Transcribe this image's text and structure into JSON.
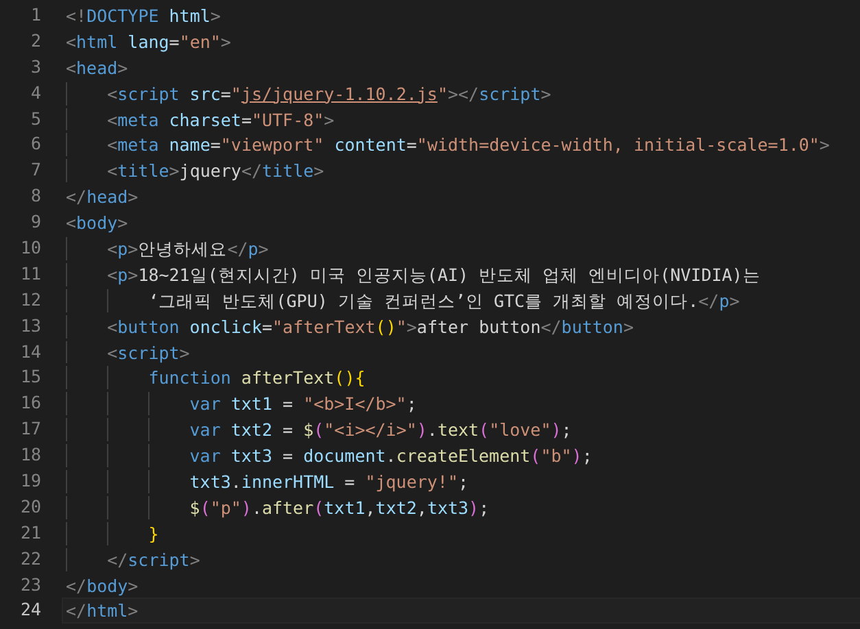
{
  "editor": {
    "lines": [
      {
        "number": "1",
        "current": false,
        "tokens": [
          {
            "kind": "punct",
            "text": "<!"
          },
          {
            "kind": "tag",
            "text": "DOCTYPE"
          },
          {
            "kind": "attr",
            "text": " html"
          },
          {
            "kind": "punct",
            "text": ">"
          }
        ]
      },
      {
        "number": "2",
        "current": false,
        "tokens": [
          {
            "kind": "punct",
            "text": "<"
          },
          {
            "kind": "tag",
            "text": "html"
          },
          {
            "kind": "attr",
            "text": " lang"
          },
          {
            "kind": "text",
            "text": "="
          },
          {
            "kind": "str",
            "text": "\"en\""
          },
          {
            "kind": "punct",
            "text": ">"
          }
        ]
      },
      {
        "number": "3",
        "current": false,
        "tokens": [
          {
            "kind": "punct",
            "text": "<"
          },
          {
            "kind": "tag",
            "text": "head"
          },
          {
            "kind": "punct",
            "text": ">"
          }
        ]
      },
      {
        "number": "4",
        "current": false,
        "tokens": [
          {
            "kind": "punct",
            "text": "    <"
          },
          {
            "kind": "tag",
            "text": "script"
          },
          {
            "kind": "attr",
            "text": " src"
          },
          {
            "kind": "text",
            "text": "="
          },
          {
            "kind": "str",
            "text": "\""
          },
          {
            "kind": "link",
            "text": "js/jquery-1.10.2.js"
          },
          {
            "kind": "str",
            "text": "\""
          },
          {
            "kind": "punct",
            "text": "></"
          },
          {
            "kind": "tag",
            "text": "script"
          },
          {
            "kind": "punct",
            "text": ">"
          }
        ]
      },
      {
        "number": "5",
        "current": false,
        "tokens": [
          {
            "kind": "punct",
            "text": "    <"
          },
          {
            "kind": "tag",
            "text": "meta"
          },
          {
            "kind": "attr",
            "text": " charset"
          },
          {
            "kind": "text",
            "text": "="
          },
          {
            "kind": "str",
            "text": "\"UTF-8\""
          },
          {
            "kind": "punct",
            "text": ">"
          }
        ]
      },
      {
        "number": "6",
        "current": false,
        "tokens": [
          {
            "kind": "punct",
            "text": "    <"
          },
          {
            "kind": "tag",
            "text": "meta"
          },
          {
            "kind": "attr",
            "text": " name"
          },
          {
            "kind": "text",
            "text": "="
          },
          {
            "kind": "str",
            "text": "\"viewport\""
          },
          {
            "kind": "attr",
            "text": " content"
          },
          {
            "kind": "text",
            "text": "="
          },
          {
            "kind": "str",
            "text": "\"width=device-width, initial-scale=1.0\""
          },
          {
            "kind": "punct",
            "text": ">"
          }
        ]
      },
      {
        "number": "7",
        "current": false,
        "tokens": [
          {
            "kind": "punct",
            "text": "    <"
          },
          {
            "kind": "tag",
            "text": "title"
          },
          {
            "kind": "punct",
            "text": ">"
          },
          {
            "kind": "text",
            "text": "jquery"
          },
          {
            "kind": "punct",
            "text": "</"
          },
          {
            "kind": "tag",
            "text": "title"
          },
          {
            "kind": "punct",
            "text": ">"
          }
        ]
      },
      {
        "number": "8",
        "current": false,
        "tokens": [
          {
            "kind": "punct",
            "text": "</"
          },
          {
            "kind": "tag",
            "text": "head"
          },
          {
            "kind": "punct",
            "text": ">"
          }
        ]
      },
      {
        "number": "9",
        "current": false,
        "tokens": [
          {
            "kind": "punct",
            "text": "<"
          },
          {
            "kind": "tag",
            "text": "body"
          },
          {
            "kind": "punct",
            "text": ">"
          }
        ]
      },
      {
        "number": "10",
        "current": false,
        "tokens": [
          {
            "kind": "punct",
            "text": "    <"
          },
          {
            "kind": "tag",
            "text": "p"
          },
          {
            "kind": "punct",
            "text": ">"
          },
          {
            "kind": "text",
            "text": "안녕하세요"
          },
          {
            "kind": "punct",
            "text": "</"
          },
          {
            "kind": "tag",
            "text": "p"
          },
          {
            "kind": "punct",
            "text": ">"
          }
        ]
      },
      {
        "number": "11",
        "current": false,
        "tokens": [
          {
            "kind": "punct",
            "text": "    <"
          },
          {
            "kind": "tag",
            "text": "p"
          },
          {
            "kind": "punct",
            "text": ">"
          },
          {
            "kind": "text",
            "text": "18~21일(현지시간) 미국 인공지능(AI) 반도체 업체 엔비디아(NVIDIA)는"
          }
        ]
      },
      {
        "number": "12",
        "current": false,
        "tokens": [
          {
            "kind": "text",
            "text": "        ‘그래픽 반도체(GPU) 기술 컨퍼런스’인 GTC를 개최할 예정이다."
          },
          {
            "kind": "punct",
            "text": "</"
          },
          {
            "kind": "tag",
            "text": "p"
          },
          {
            "kind": "punct",
            "text": ">"
          }
        ]
      },
      {
        "number": "13",
        "current": false,
        "tokens": [
          {
            "kind": "punct",
            "text": "    <"
          },
          {
            "kind": "tag",
            "text": "button"
          },
          {
            "kind": "attr",
            "text": " onclick"
          },
          {
            "kind": "text",
            "text": "="
          },
          {
            "kind": "str",
            "text": "\"afterText"
          },
          {
            "kind": "bracket1",
            "text": "()"
          },
          {
            "kind": "str",
            "text": "\""
          },
          {
            "kind": "punct",
            "text": ">"
          },
          {
            "kind": "text",
            "text": "after button"
          },
          {
            "kind": "punct",
            "text": "</"
          },
          {
            "kind": "tag",
            "text": "button"
          },
          {
            "kind": "punct",
            "text": ">"
          }
        ]
      },
      {
        "number": "14",
        "current": false,
        "tokens": [
          {
            "kind": "punct",
            "text": "    <"
          },
          {
            "kind": "tag",
            "text": "script"
          },
          {
            "kind": "punct",
            "text": ">"
          }
        ]
      },
      {
        "number": "15",
        "current": false,
        "tokens": [
          {
            "kind": "keyword",
            "text": "        function"
          },
          {
            "kind": "func",
            "text": " afterText"
          },
          {
            "kind": "bracket1",
            "text": "(){"
          }
        ]
      },
      {
        "number": "16",
        "current": false,
        "tokens": [
          {
            "kind": "keyword",
            "text": "            var"
          },
          {
            "kind": "var",
            "text": " txt1"
          },
          {
            "kind": "text",
            "text": " = "
          },
          {
            "kind": "str",
            "text": "\"<b>I</b>\""
          },
          {
            "kind": "text",
            "text": ";"
          }
        ]
      },
      {
        "number": "17",
        "current": false,
        "tokens": [
          {
            "kind": "keyword",
            "text": "            var"
          },
          {
            "kind": "var",
            "text": " txt2"
          },
          {
            "kind": "text",
            "text": " = "
          },
          {
            "kind": "func",
            "text": "$"
          },
          {
            "kind": "bracket2",
            "text": "("
          },
          {
            "kind": "str",
            "text": "\"<i></i>\""
          },
          {
            "kind": "bracket2",
            "text": ")"
          },
          {
            "kind": "text",
            "text": "."
          },
          {
            "kind": "func",
            "text": "text"
          },
          {
            "kind": "bracket2",
            "text": "("
          },
          {
            "kind": "str",
            "text": "\"love\""
          },
          {
            "kind": "bracket2",
            "text": ")"
          },
          {
            "kind": "text",
            "text": ";"
          }
        ]
      },
      {
        "number": "18",
        "current": false,
        "tokens": [
          {
            "kind": "keyword",
            "text": "            var"
          },
          {
            "kind": "var",
            "text": " txt3"
          },
          {
            "kind": "text",
            "text": " = "
          },
          {
            "kind": "var",
            "text": "document"
          },
          {
            "kind": "text",
            "text": "."
          },
          {
            "kind": "func",
            "text": "createElement"
          },
          {
            "kind": "bracket2",
            "text": "("
          },
          {
            "kind": "str",
            "text": "\"b\""
          },
          {
            "kind": "bracket2",
            "text": ")"
          },
          {
            "kind": "text",
            "text": ";"
          }
        ]
      },
      {
        "number": "19",
        "current": false,
        "tokens": [
          {
            "kind": "var",
            "text": "            txt3"
          },
          {
            "kind": "text",
            "text": "."
          },
          {
            "kind": "var",
            "text": "innerHTML"
          },
          {
            "kind": "text",
            "text": " = "
          },
          {
            "kind": "str",
            "text": "\"jquery!\""
          },
          {
            "kind": "text",
            "text": ";"
          }
        ]
      },
      {
        "number": "20",
        "current": false,
        "tokens": [
          {
            "kind": "func",
            "text": "            $"
          },
          {
            "kind": "bracket2",
            "text": "("
          },
          {
            "kind": "str",
            "text": "\"p\""
          },
          {
            "kind": "bracket2",
            "text": ")"
          },
          {
            "kind": "text",
            "text": "."
          },
          {
            "kind": "func",
            "text": "after"
          },
          {
            "kind": "bracket2",
            "text": "("
          },
          {
            "kind": "var",
            "text": "txt1"
          },
          {
            "kind": "text",
            "text": ","
          },
          {
            "kind": "var",
            "text": "txt2"
          },
          {
            "kind": "text",
            "text": ","
          },
          {
            "kind": "var",
            "text": "txt3"
          },
          {
            "kind": "bracket2",
            "text": ")"
          },
          {
            "kind": "text",
            "text": ";"
          }
        ]
      },
      {
        "number": "21",
        "current": false,
        "tokens": [
          {
            "kind": "bracket1",
            "text": "        }"
          }
        ]
      },
      {
        "number": "22",
        "current": false,
        "tokens": [
          {
            "kind": "punct",
            "text": "    </"
          },
          {
            "kind": "tag",
            "text": "script"
          },
          {
            "kind": "punct",
            "text": ">"
          }
        ]
      },
      {
        "number": "23",
        "current": false,
        "tokens": [
          {
            "kind": "punct",
            "text": "</"
          },
          {
            "kind": "tag",
            "text": "body"
          },
          {
            "kind": "punct",
            "text": ">"
          }
        ]
      },
      {
        "number": "24",
        "current": true,
        "tokens": [
          {
            "kind": "punct",
            "text": "</"
          },
          {
            "kind": "tag",
            "text": "html"
          },
          {
            "kind": "punct",
            "text": ">"
          }
        ]
      }
    ]
  }
}
